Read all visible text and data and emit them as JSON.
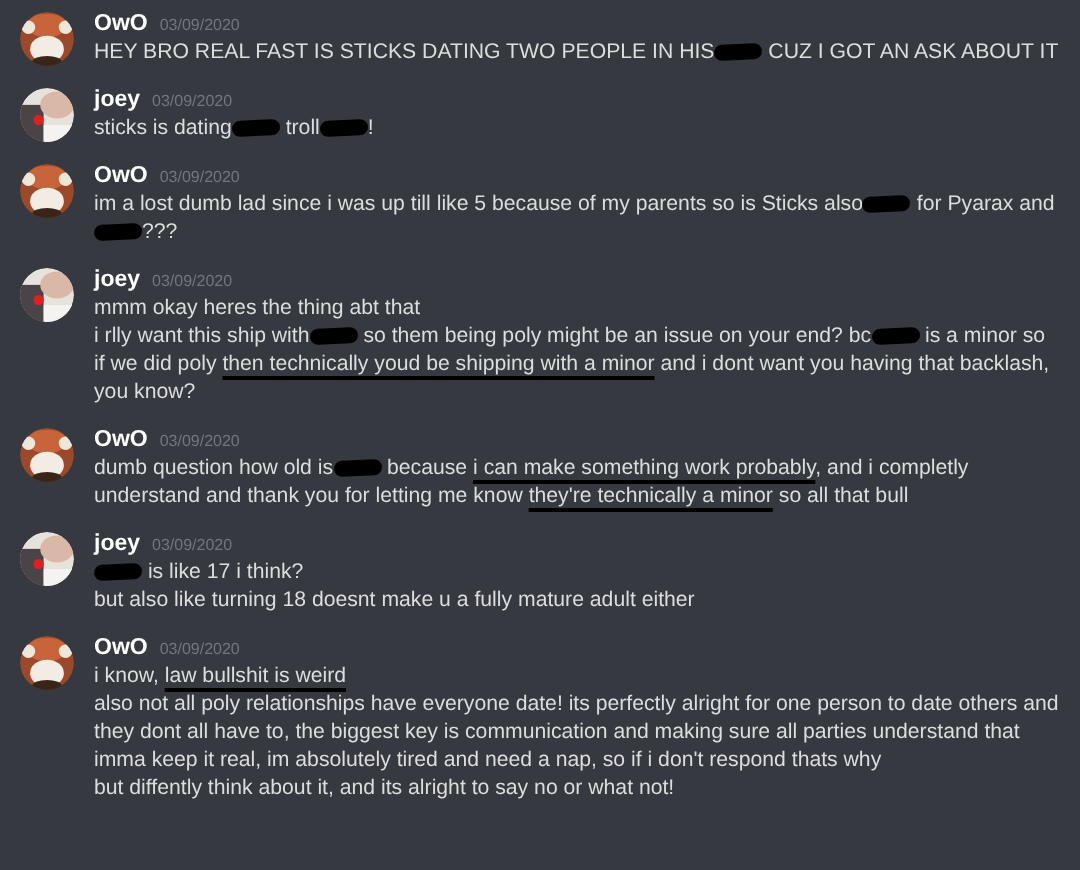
{
  "messages": [
    {
      "author": "OwO",
      "timestamp": "03/09/2020",
      "avatar": {
        "kind": "picture"
      },
      "paragraphs": [
        [
          {
            "kind": "text",
            "text": "HEY BRO REAL FAST IS STICKS DATING TWO PEOPLE IN HIS"
          },
          {
            "kind": "redacted"
          },
          {
            "kind": "text",
            "text": " CUZ I GOT AN ASK ABOUT IT"
          }
        ]
      ]
    },
    {
      "author": "joey",
      "timestamp": "03/09/2020",
      "avatar": {
        "kind": "picture"
      },
      "paragraphs": [
        [
          {
            "kind": "text",
            "text": "sticks is dating"
          },
          {
            "kind": "redacted"
          },
          {
            "kind": "text",
            "text": " troll"
          },
          {
            "kind": "redacted"
          },
          {
            "kind": "text",
            "text": "!"
          }
        ]
      ]
    },
    {
      "author": "OwO",
      "timestamp": "03/09/2020",
      "avatar": {
        "kind": "picture"
      },
      "paragraphs": [
        [
          {
            "kind": "text",
            "text": "im a lost dumb lad since i was up till like 5 because of my parents so is Sticks also"
          },
          {
            "kind": "redacted"
          },
          {
            "kind": "text",
            "text": " for Pyarax and "
          },
          {
            "kind": "redacted"
          },
          {
            "kind": "text",
            "text": "???"
          }
        ]
      ]
    },
    {
      "author": "joey",
      "timestamp": "03/09/2020",
      "avatar": {
        "kind": "picture"
      },
      "paragraphs": [
        [
          {
            "kind": "text",
            "text": "mmm okay heres the thing abt that"
          }
        ],
        [
          {
            "kind": "text",
            "text": "i rlly want this ship with"
          },
          {
            "kind": "redacted"
          },
          {
            "kind": "text",
            "text": " so them being poly might be an issue on your end? bc"
          },
          {
            "kind": "redacted"
          },
          {
            "kind": "text",
            "text": " is a minor so if we did poly "
          },
          {
            "kind": "underlined",
            "text": "then technically youd be shipping with a minor"
          },
          {
            "kind": "text",
            "text": " and i dont want you having that backlash, you know?"
          }
        ]
      ]
    },
    {
      "author": "OwO",
      "timestamp": "03/09/2020",
      "avatar": {
        "kind": "picture"
      },
      "paragraphs": [
        [
          {
            "kind": "text",
            "text": "dumb question how old is"
          },
          {
            "kind": "redacted"
          },
          {
            "kind": "text",
            "text": " because "
          },
          {
            "kind": "underlined",
            "text": "i can make something work probably"
          },
          {
            "kind": "text",
            "text": ", and i completly understand and thank you for letting me know "
          },
          {
            "kind": "underlined",
            "text": "they're technically a minor"
          },
          {
            "kind": "text",
            "text": " so all that bull"
          }
        ]
      ]
    },
    {
      "author": "joey",
      "timestamp": "03/09/2020",
      "avatar": {
        "kind": "picture"
      },
      "paragraphs": [
        [
          {
            "kind": "redacted"
          },
          {
            "kind": "text",
            "text": " is like 17 i think?"
          }
        ],
        [
          {
            "kind": "text",
            "text": "but also like turning 18 doesnt make u a fully mature adult either"
          }
        ]
      ]
    },
    {
      "author": "OwO",
      "timestamp": "03/09/2020",
      "avatar": {
        "kind": "picture"
      },
      "paragraphs": [
        [
          {
            "kind": "text",
            "text": "i know, "
          },
          {
            "kind": "underlined",
            "text": "law bullshit is weird"
          }
        ],
        [
          {
            "kind": "text",
            "text": "also not all poly relationships have everyone date! its perfectly alright for one person to date others and they dont all have to, the biggest key is communication and making sure all parties understand that"
          }
        ],
        [
          {
            "kind": "text",
            "text": "imma keep it real, im absolutely tired and need a nap, so if i don't respond thats why"
          }
        ],
        [
          {
            "kind": "text",
            "text": "but diffently think about it, and its alright to say no or what not!"
          }
        ]
      ]
    }
  ]
}
